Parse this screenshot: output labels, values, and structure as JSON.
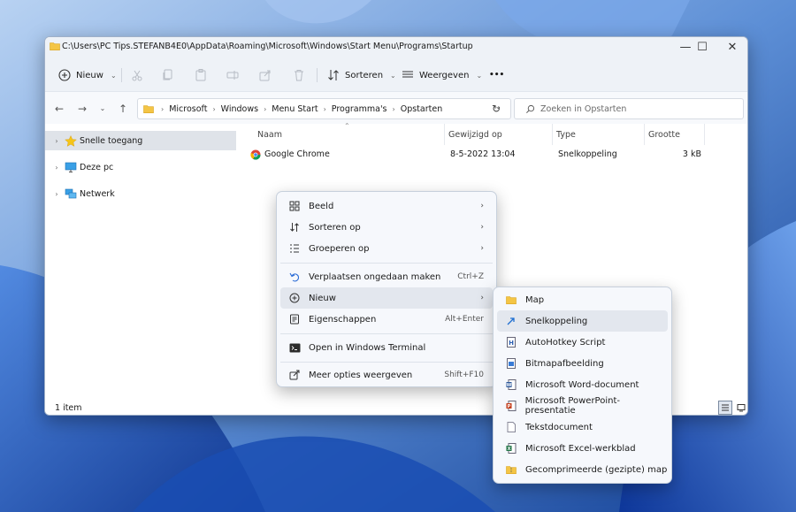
{
  "window": {
    "title": "C:\\Users\\PC Tips.STEFANB4E0\\AppData\\Roaming\\Microsoft\\Windows\\Start Menu\\Programs\\Startup",
    "controls": {
      "minimize": "—",
      "maximize": "☐",
      "close": "✕"
    }
  },
  "toolbar": {
    "new_label": "Nieuw",
    "sort_label": "Sorteren",
    "view_label": "Weergeven",
    "more_label": "•••"
  },
  "address": {
    "breadcrumbs": [
      "Microsoft",
      "Windows",
      "Menu Start",
      "Programma's",
      "Opstarten"
    ],
    "search_placeholder": "Zoeken in Opstarten"
  },
  "nav": {
    "items": [
      {
        "label": "Snelle toegang",
        "icon": "star-icon"
      },
      {
        "label": "Deze pc",
        "icon": "monitor-icon"
      },
      {
        "label": "Netwerk",
        "icon": "network-icon"
      }
    ]
  },
  "columns": {
    "name": "Naam",
    "modified": "Gewijzigd op",
    "type": "Type",
    "size": "Grootte"
  },
  "files": [
    {
      "name": "Google Chrome",
      "modified": "8-5-2022 13:04",
      "type": "Snelkoppeling",
      "size": "3 kB",
      "icon": "chrome-icon"
    }
  ],
  "status": {
    "count": "1 item"
  },
  "context_menu": {
    "items": [
      {
        "label": "Beeld",
        "shortcut": "",
        "icon": "grid-icon",
        "submenu": true
      },
      {
        "label": "Sorteren op",
        "shortcut": "",
        "icon": "sort-icon",
        "submenu": true
      },
      {
        "label": "Groeperen op",
        "shortcut": "",
        "icon": "group-icon",
        "submenu": true
      },
      {
        "label": "Verplaatsen ongedaan maken",
        "shortcut": "Ctrl+Z",
        "icon": "undo-icon",
        "submenu": false
      },
      {
        "label": "Nieuw",
        "shortcut": "",
        "icon": "plus-circle-icon",
        "submenu": true
      },
      {
        "label": "Eigenschappen",
        "shortcut": "Alt+Enter",
        "icon": "properties-icon",
        "submenu": false
      },
      {
        "label": "Open in Windows Terminal",
        "shortcut": "",
        "icon": "terminal-icon",
        "submenu": false
      },
      {
        "label": "Meer opties weergeven",
        "shortcut": "Shift+F10",
        "icon": "share-icon",
        "submenu": false
      }
    ],
    "arrow": "›"
  },
  "submenu": {
    "items": [
      {
        "label": "Map",
        "icon": "folder-icon"
      },
      {
        "label": "Snelkoppeling",
        "icon": "shortcut-icon"
      },
      {
        "label": "AutoHotkey Script",
        "icon": "autohotkey-icon"
      },
      {
        "label": "Bitmapafbeelding",
        "icon": "bitmap-icon"
      },
      {
        "label": "Microsoft Word-document",
        "icon": "word-icon"
      },
      {
        "label": "Microsoft PowerPoint-presentatie",
        "icon": "powerpoint-icon"
      },
      {
        "label": "Tekstdocument",
        "icon": "text-document-icon"
      },
      {
        "label": "Microsoft Excel-werkblad",
        "icon": "excel-icon"
      },
      {
        "label": "Gecomprimeerde (gezipte) map",
        "icon": "zip-folder-icon"
      }
    ]
  },
  "colors": {
    "wallpaper_dark": "#0b3d91",
    "wallpaper_light": "#8fbaf0",
    "menu_highlight": "#e3e7ee",
    "folder": "#f4c545"
  }
}
